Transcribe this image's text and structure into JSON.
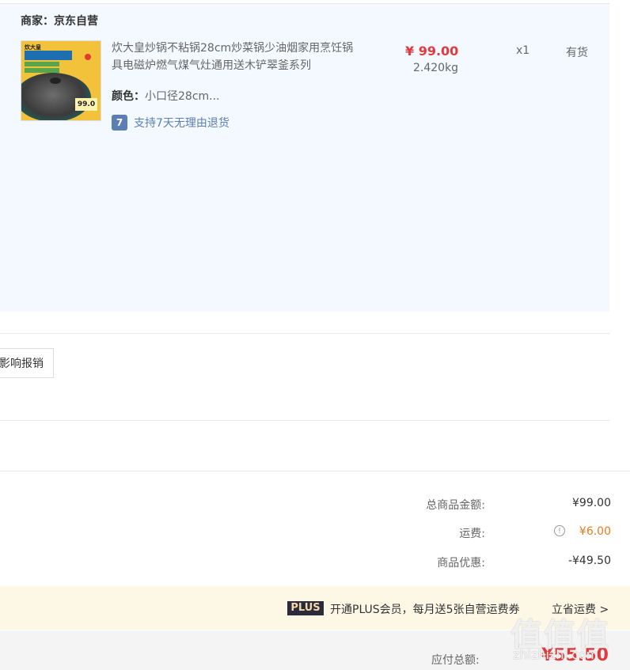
{
  "shop": {
    "name": "商家：京东自营"
  },
  "item": {
    "thumbnail_brand": "炊大皇",
    "thumbnail_price": "99.0",
    "title": "炊大皇炒锅不粘锅28cm炒菜锅少油烟家用烹饪锅具电磁炉燃气煤气灶通用送木铲翠釜系列",
    "color_label": "颜色：",
    "color_value": "小口径28cm...",
    "return_policy": "支持7天无理由退货",
    "return_icon": "7",
    "price": "¥ 99.00",
    "weight": "2.420kg",
    "quantity": "x1",
    "stock": "有货"
  },
  "invoice_button": "影响报销",
  "summary": {
    "goods_label": "总商品金额:",
    "goods_value": "¥99.00",
    "shipping_label": "运费:",
    "shipping_value": "¥6.00",
    "discount_label": "商品优惠:",
    "discount_value": "-¥49.50"
  },
  "plus": {
    "badge": "PLUS",
    "text": "开通PLUS会员，每月送5张自营运费券",
    "link": "立省运费 >"
  },
  "total": {
    "label": "应付总额:",
    "value": "¥55.50"
  },
  "watermark": {
    "text": "值值值",
    "url": "zhizhizhi.com"
  },
  "colors": {
    "accent_red": "#e4393c",
    "shipping_orange": "#e87b1a",
    "panel_bg": "#f3f9fe",
    "link_blue": "#5b7fb5"
  },
  "icons": {
    "info": "info-circle-icon",
    "return": "return-policy-icon"
  }
}
